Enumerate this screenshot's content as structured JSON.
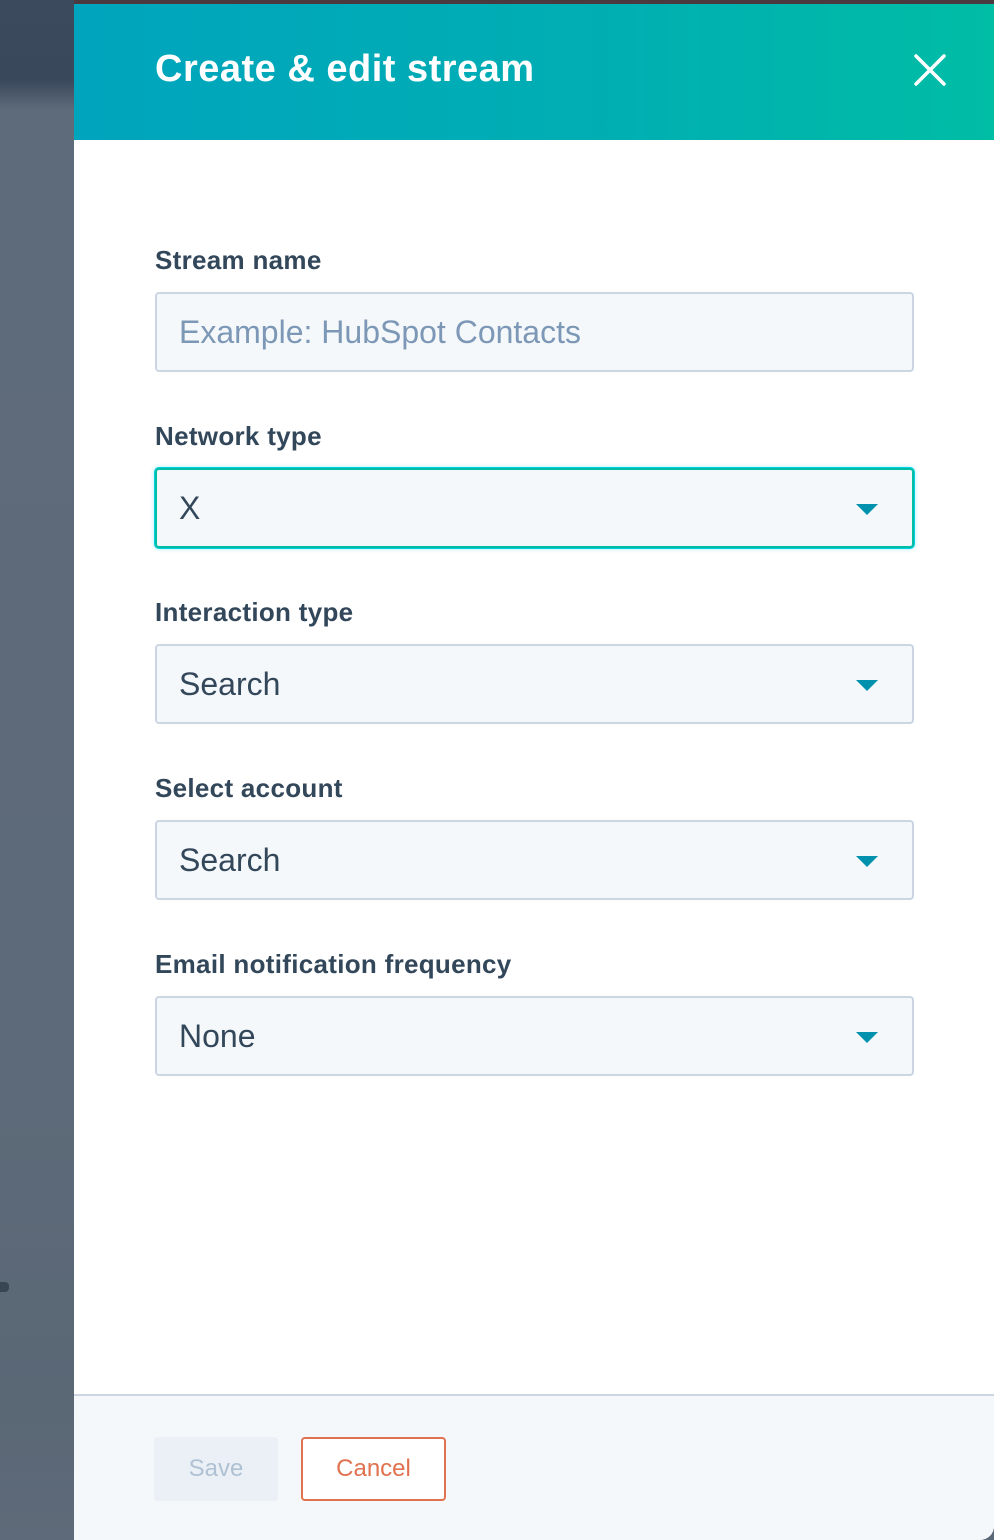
{
  "panel": {
    "title": "Create & edit stream",
    "close_icon": "close-icon"
  },
  "fields": {
    "stream_name": {
      "label": "Stream name",
      "value": "",
      "placeholder": "Example: HubSpot Contacts"
    },
    "network_type": {
      "label": "Network type",
      "value": "X",
      "focused": true
    },
    "interaction_type": {
      "label": "Interaction type",
      "value": "Search"
    },
    "select_account": {
      "label": "Select account",
      "value": "Search"
    },
    "email_frequency": {
      "label": "Email notification frequency",
      "value": "None"
    }
  },
  "footer": {
    "save_label": "Save",
    "save_disabled": true,
    "cancel_label": "Cancel"
  },
  "colors": {
    "header_start": "#00a4bd",
    "header_end": "#00bda5",
    "caret": "#0091ae",
    "cancel": "#e07250",
    "label_text": "#33475b",
    "placeholder": "#7c98b6"
  }
}
